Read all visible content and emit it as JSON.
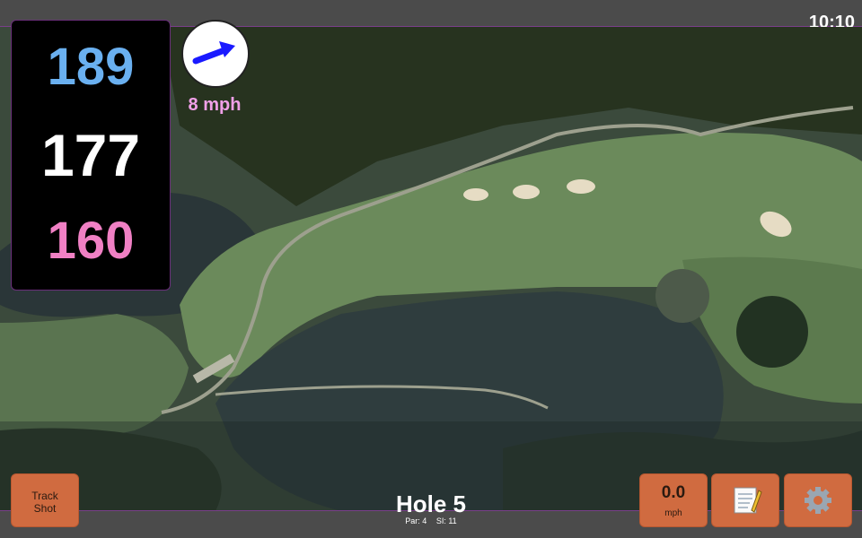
{
  "status_bar": {
    "time": "10:10"
  },
  "yardage": {
    "back": "189",
    "middle": "177",
    "front": "160"
  },
  "wind": {
    "speed": "8 mph",
    "direction_icon": "wind-arrow-icon"
  },
  "hole": {
    "title": "Hole 5",
    "par": "Par: 4",
    "stroke_index": "SI: 11"
  },
  "buttons": {
    "track_shot_line1": "Track",
    "track_shot_line2": "Shot",
    "speed_value": "0.0",
    "speed_unit": "mph",
    "notes_icon": "notepad-icon",
    "settings_icon": "gear-icon"
  },
  "colors": {
    "back_yardage": "#6ab0f0",
    "middle_yardage": "#ffffff",
    "front_yardage": "#f080c4",
    "button": "#d06b40",
    "accent_border": "#7a3f8a"
  }
}
